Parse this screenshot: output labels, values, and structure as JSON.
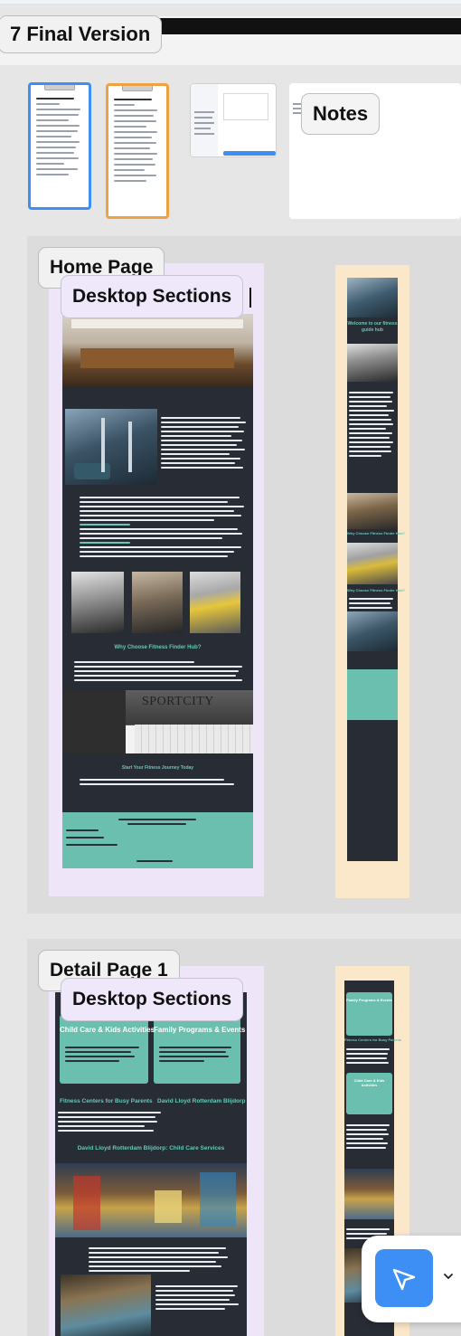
{
  "frame": {
    "title": "7 Final Version"
  },
  "thumbnails": {
    "notes_label": "Notes"
  },
  "home": {
    "page_label": "Home Page",
    "desktop_label": "Desktop Sections",
    "mobile_welcome": "Welcome to our fitness guide hub",
    "why_heading": "Why Choose Fitness Finder Hub?",
    "start_heading": "Start Your Fitness Journey Today",
    "sportcity_sign": "SPORTCITY",
    "mobile_why": "Why Choose Fitness Finder Hub?",
    "mobile_why2": "Why Choose Fitness Finder Hub?"
  },
  "detail": {
    "page_label": "Detail Page 1",
    "desktop_label": "Desktop Sections",
    "card1_title": "Child Care & Kids Activities",
    "card2_title": "Family Programs & Events",
    "sub1": "Fitness Centers for Busy Parents",
    "sub2": "David Lloyd Rotterdam Blijdorp",
    "childcare_heading": "David Lloyd Rotterdam Blijdorp: Child Care Services",
    "mobile_card1": "Family Programs & Events",
    "mobile_sub": "Fitness Centers for Busy Parents",
    "mobile_card2": "Child Care & Kids Activities"
  },
  "colors": {
    "accent_blue": "#3d8ff5",
    "teal": "#6bbfae",
    "dark": "#272c35",
    "home_bg": "#eee6f8",
    "mobile_bg": "#fbe7c9"
  },
  "icons": {
    "cursor": "cursor-arrow-icon",
    "chevron": "chevron-down-icon"
  }
}
